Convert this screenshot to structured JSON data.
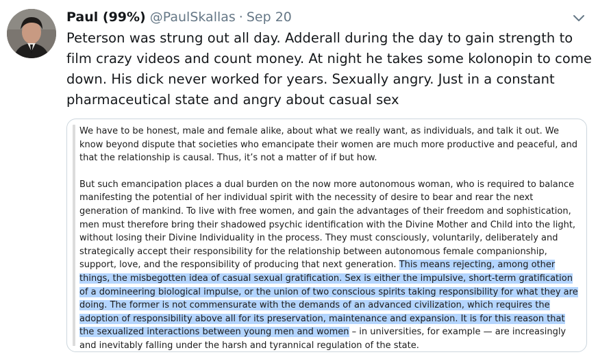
{
  "tweet": {
    "author_name": "Paul (99%)",
    "handle": "@PaulSkallas",
    "separator": "·",
    "date": "Sep 20",
    "text": "Peterson was strung out all day. Adderall during the day to gain strength to film crazy videos and count money. At night he takes some kolonopin to come down. His dick never worked for years. Sexually angry. Just in a constant pharmaceutical state and angry about casual sex",
    "icons": {
      "avatar": "profile-photo",
      "menu": "chevron-down-icon"
    }
  },
  "quote": {
    "paragraph1": "We have to be honest, male and female alike, about what we really want, as individuals, and talk it out. We know beyond dispute that societies who emancipate their women are much more productive and peaceful, and that the relationship is causal. Thus, it’s not a matter of if but how.",
    "paragraph2_plain": "But such emancipation places a dual burden on the now more autonomous woman, who is required to balance manifesting the potential of her individual spirit with the necessity of desire to bear and rear the next generation of mankind. To live with free women, and gain the advantages of their freedom and sophistication, men must therefore bring their shadowed psychic identification with the Divine Mother and Child into the light, without losing their Divine Individuality in the process. They must consciously, voluntarily, deliberately and strategically accept their responsibility for the relationship between autonomous female companionship, support, love, and the responsibility of producing that next generation. ",
    "paragraph2_highlighted": "This means rejecting, among other things, the misbegotten idea of casual sexual gratification. Sex is either the impulsive, short-term gratification of a domineering biological impulse, or the union of two conscious spirits taking responsibility for what they are doing. The former is not commensurate with the demands of an advanced civilization, which requires the adoption of responsibility above all for its preservation, maintenance and expansion. It is for this reason that the sexualized interactions between young men and women",
    "paragraph2_end": " – in universities, for example — are increasingly and inevitably falling under the harsh and tyrannical regulation of the state.",
    "highlight_color": "#b4d5fe"
  }
}
